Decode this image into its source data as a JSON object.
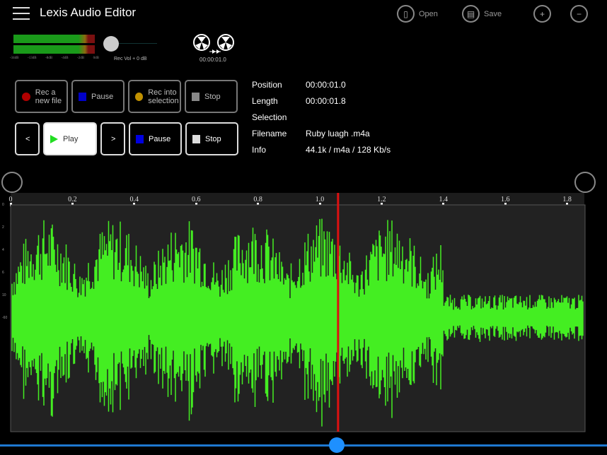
{
  "app": {
    "title": "Lexis Audio Editor",
    "menu_icon": "hamburger-icon"
  },
  "toolbar": {
    "open_label": "Open",
    "save_label": "Save"
  },
  "meter": {
    "labels": [
      "-34dB",
      "-13dB",
      "-8dB",
      "-4dB",
      "-2dB",
      "0dB"
    ],
    "level_fraction": 0.98
  },
  "rec_volume": {
    "label": "Rec Vol + 0 dB",
    "value_fraction": 0
  },
  "tape": {
    "time": "00:00:01.0"
  },
  "record_buttons": [
    {
      "label": "Rec a new file",
      "color": "#b00000"
    },
    {
      "label": "Pause",
      "color": "#0000c8"
    },
    {
      "label": "Rec into selection",
      "color": "#c09000"
    },
    {
      "label": "Stop",
      "color": "#888888"
    }
  ],
  "play_buttons": {
    "prev": "<",
    "play": "Play",
    "next": ">",
    "pause": "Pause",
    "stop": "Stop",
    "play_color": "#22dd22",
    "pause_color": "#0000e0",
    "stop_color": "#dddddd"
  },
  "info": [
    {
      "label": "Position",
      "value": "00:00:01.0"
    },
    {
      "label": "Length",
      "value": "00:00:01.8"
    },
    {
      "label": "Selection",
      "value": ""
    },
    {
      "label": "Filename",
      "value": "Ruby luagh .m4a"
    },
    {
      "label": "Info",
      "value": "44.1k / m4a / 128 Kb/s"
    }
  ],
  "timeline": {
    "ticks": [
      "0",
      "0.2",
      "0.4",
      "0.6",
      "0.8",
      "1.0",
      "1.2",
      "1.4",
      "1.6",
      "1.8"
    ],
    "y_labels": [
      "0",
      "2",
      "4",
      "6",
      "10",
      "-60"
    ],
    "length_s": 1.8,
    "playhead_s": 1.05,
    "wave_color": "#44ee22",
    "playhead_color": "#dd1111"
  },
  "scrub": {
    "position_fraction": 0.555,
    "color": "#1e90ff"
  }
}
